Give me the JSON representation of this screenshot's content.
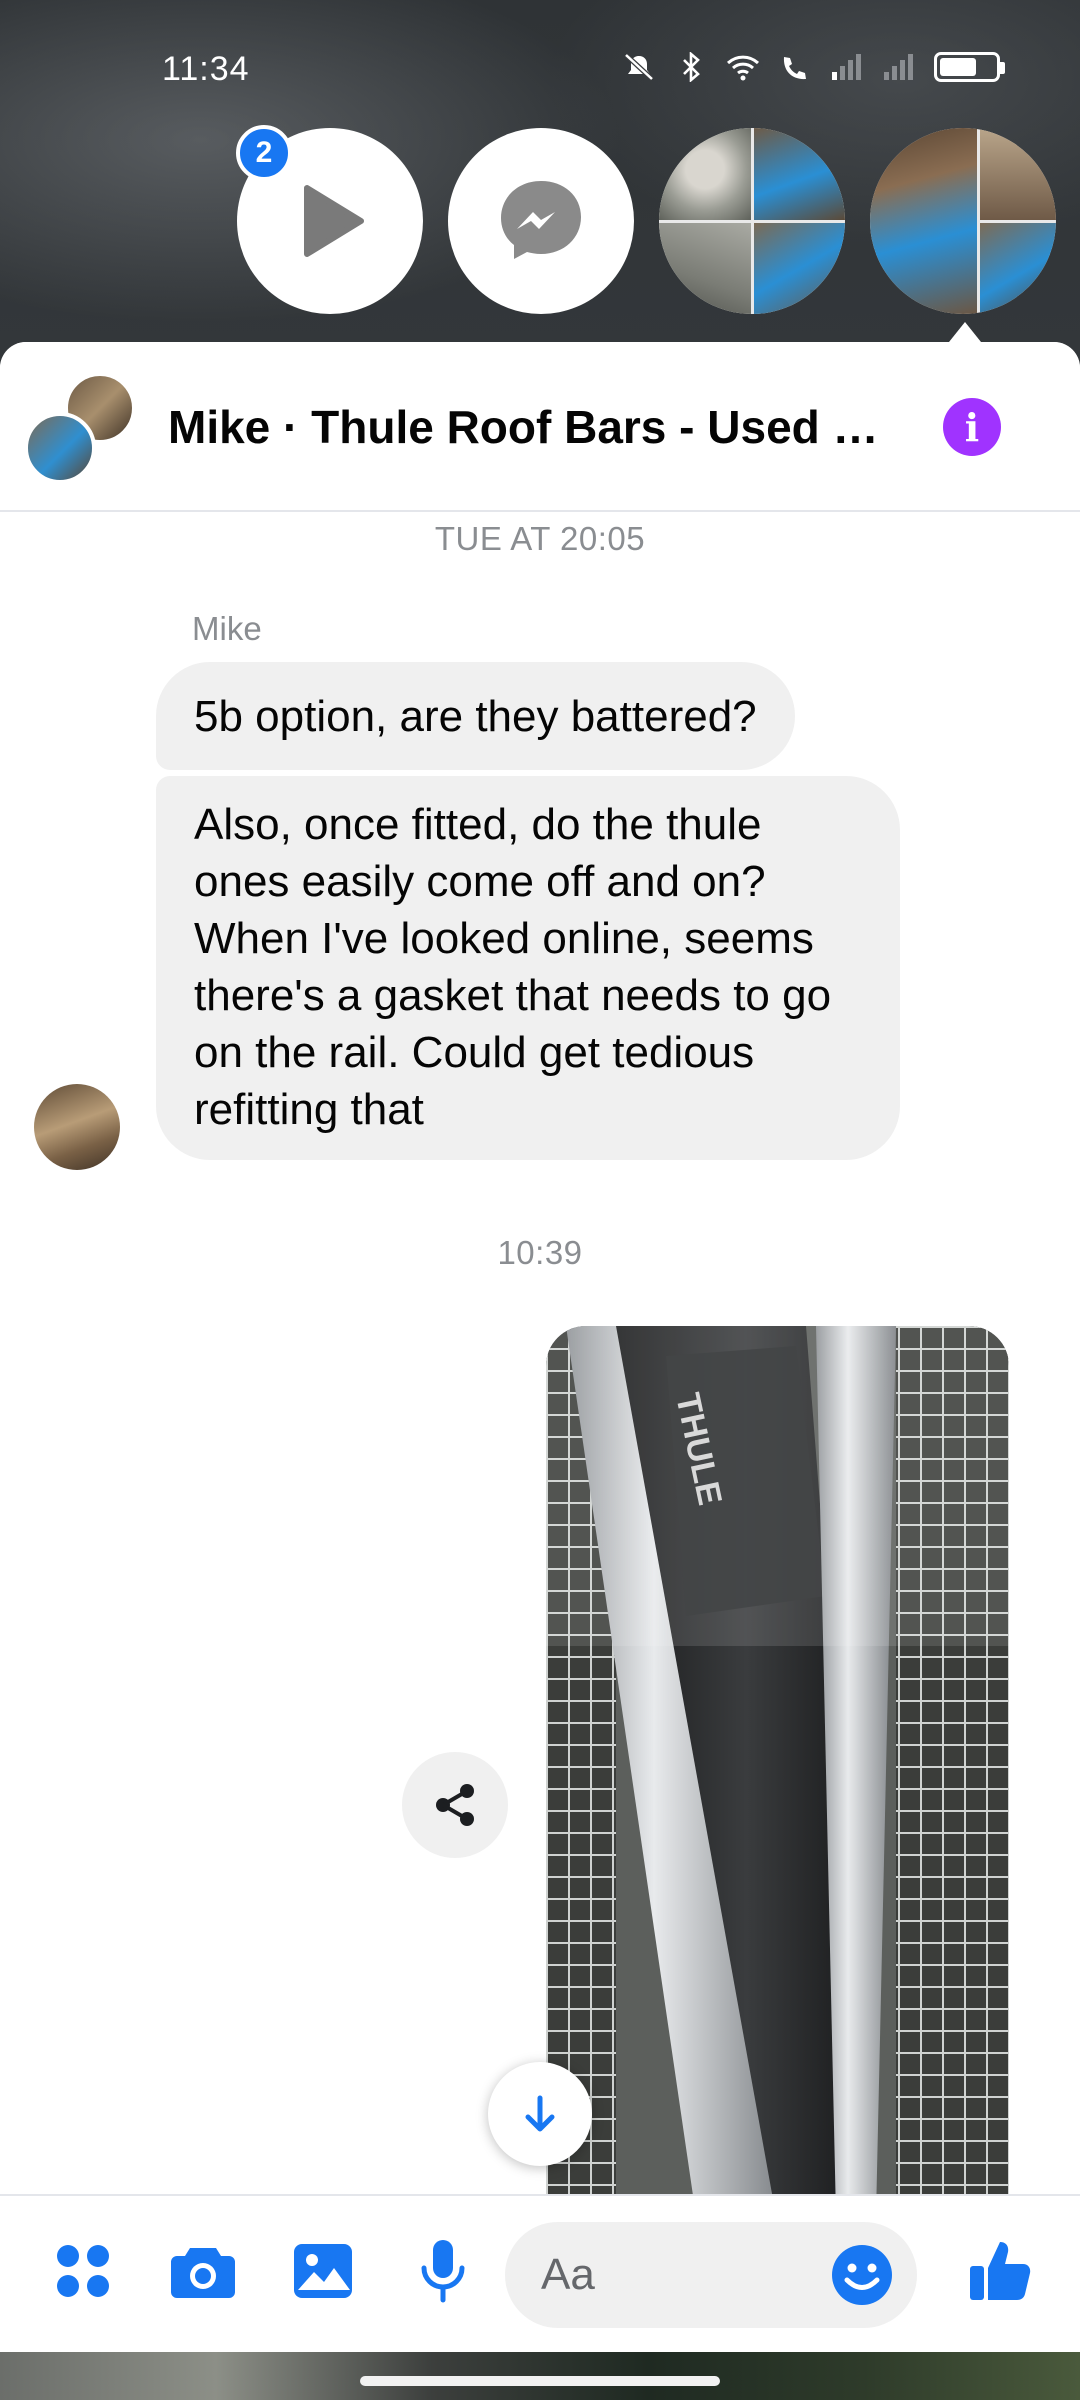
{
  "status_bar": {
    "time": "11:34"
  },
  "chat_heads": {
    "unread_badge": "2",
    "items": [
      {
        "name": "video-play"
      },
      {
        "name": "messenger"
      },
      {
        "name": "group-photo-1"
      },
      {
        "name": "group-photo-2"
      }
    ]
  },
  "conversation": {
    "title": "Mike · Thule Roof Bars - Used &...",
    "info_icon": "info-icon"
  },
  "messages": {
    "timestamp_1": "TUE AT 20:05",
    "sender_name": "Mike",
    "bubble_1": "5b option, are they battered?",
    "bubble_2": "Also, once fitted, do the thule ones easily come off and on? When I've looked online, seems there's a gasket that needs to go on the rail. Could get tedious refitting that",
    "timestamp_2": "10:39",
    "photo_text": "THULE"
  },
  "composer": {
    "placeholder": "Aa",
    "icons": [
      "apps-icon",
      "camera-icon",
      "gallery-icon",
      "microphone-icon",
      "emoji-icon",
      "thumbs-up-icon"
    ]
  },
  "colors": {
    "accent": "#1877f2",
    "info": "#a033ff",
    "bubble": "#f0f0f0",
    "meta_text": "#8a8d91"
  }
}
